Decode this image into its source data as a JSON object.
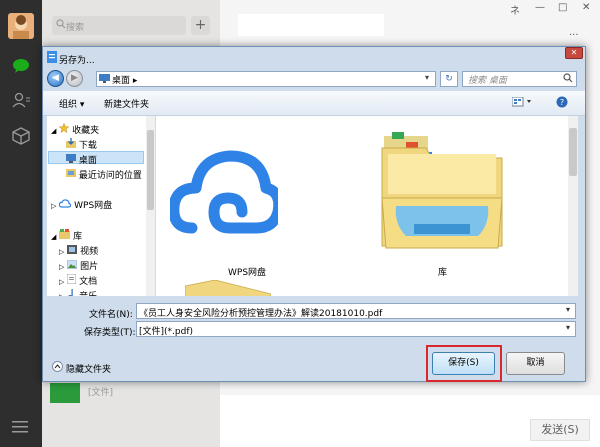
{
  "wechat": {
    "search_placeholder": "搜索",
    "plus": "+",
    "send_label": "发送(S)",
    "file_tag": "[文件]",
    "window_controls": [
      "ネ",
      "—",
      "□",
      "✕"
    ],
    "more": "···"
  },
  "dialog": {
    "title": "另存为...",
    "address": "桌面",
    "address_arrow": "▸",
    "search_placeholder": "搜索 桌面",
    "toolbar": {
      "organize": "组织 ▾",
      "new_folder": "新建文件夹"
    },
    "nav": [
      {
        "label": "收藏夹"
      },
      {
        "label": "下载"
      },
      {
        "label": "桌面"
      },
      {
        "label": "最近访问的位置"
      },
      {
        "label": "WPS网盘"
      },
      {
        "label": "库"
      },
      {
        "label": "视频"
      },
      {
        "label": "图片"
      },
      {
        "label": "文档"
      },
      {
        "label": "音乐"
      }
    ],
    "items": [
      {
        "label": "WPS网盘"
      },
      {
        "label": "库"
      }
    ],
    "filename_label": "文件名(N):",
    "filename_value": "《员工人身安全风险分析预控管理办法》解读20181010.pdf",
    "filetype_label": "保存类型(T):",
    "filetype_value": "[文件](*.pdf)",
    "hide_folders": "隐藏文件夹",
    "save_label": "保存(S)",
    "cancel_label": "取消"
  },
  "colors": {
    "accent": "#1aad19",
    "dialog_bg": "#cfdcec",
    "highlight": "#d9282d",
    "cloud": "#2f82e6"
  }
}
